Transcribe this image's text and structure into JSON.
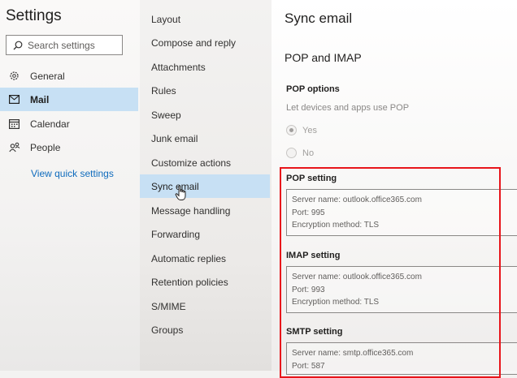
{
  "app": {
    "title": "Settings"
  },
  "search": {
    "placeholder": "Search settings"
  },
  "categories": [
    {
      "label": "General",
      "icon": "gear-icon"
    },
    {
      "label": "Mail",
      "icon": "mail-icon",
      "selected": true
    },
    {
      "label": "Calendar",
      "icon": "calendar-icon"
    },
    {
      "label": "People",
      "icon": "people-icon"
    }
  ],
  "quick_settings_link": "View quick settings",
  "mail_subcategories": [
    "Layout",
    "Compose and reply",
    "Attachments",
    "Rules",
    "Sweep",
    "Junk email",
    "Customize actions",
    "Sync email",
    "Message handling",
    "Forwarding",
    "Automatic replies",
    "Retention policies",
    "S/MIME",
    "Groups"
  ],
  "selected_subcategory": "Sync email",
  "main": {
    "title": "Sync email",
    "section_title": "POP and IMAP",
    "pop_options": {
      "heading": "POP options",
      "description": "Let devices and apps use POP",
      "yes_label": "Yes",
      "no_label": "No",
      "selected": "Yes"
    },
    "pop_setting": {
      "label": "POP setting",
      "server": "Server name: outlook.office365.com",
      "port": "Port: 995",
      "encryption": "Encryption method: TLS"
    },
    "imap_setting": {
      "label": "IMAP setting",
      "server": "Server name: outlook.office365.com",
      "port": "Port: 993",
      "encryption": "Encryption method: TLS"
    },
    "smtp_setting": {
      "label": "SMTP setting",
      "server": "Server name: smtp.office365.com",
      "port": "Port: 587"
    }
  },
  "colors": {
    "selected_bg": "#c7e0f4",
    "link": "#0f6cbd",
    "highlight_border": "#e8151b"
  }
}
